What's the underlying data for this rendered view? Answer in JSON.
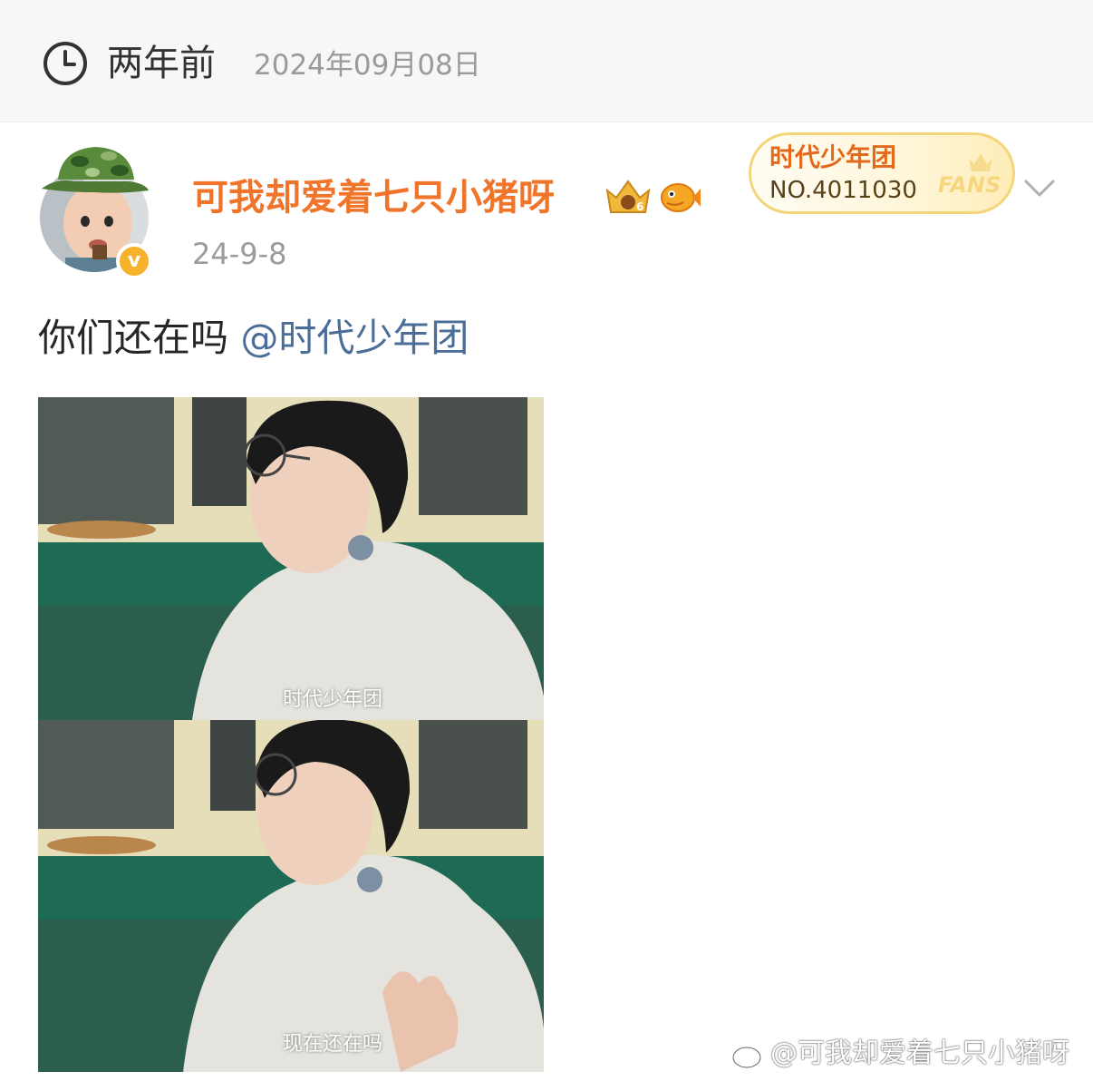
{
  "header": {
    "relative_time": "两年前",
    "full_date": "2024年09月08日",
    "clock_icon": "clock-icon"
  },
  "post": {
    "author": {
      "name": "可我却爱着七只小猪呀",
      "verified_mark": "v",
      "avatar_icon": "avatar-baby-camo-hat",
      "badges": [
        "crown-badge-icon",
        "fish-badge-icon"
      ]
    },
    "time": "24-9-8",
    "fan_badge": {
      "group": "时代少年团",
      "number": "NO.4011030",
      "label": "FANS"
    },
    "text": "你们还在吗",
    "mention": "@时代少年团",
    "images": [
      {
        "subtitle": "时代少年团"
      },
      {
        "subtitle": "现在还在吗"
      }
    ]
  },
  "watermark": {
    "text": "@可我却爱着七只小猪呀",
    "logo_icon": "weibo-logo-icon"
  },
  "colors": {
    "author": "#f0742a",
    "mention": "#4a6e98",
    "meta": "#9b9b9b",
    "fans_border": "#f5d57a"
  }
}
